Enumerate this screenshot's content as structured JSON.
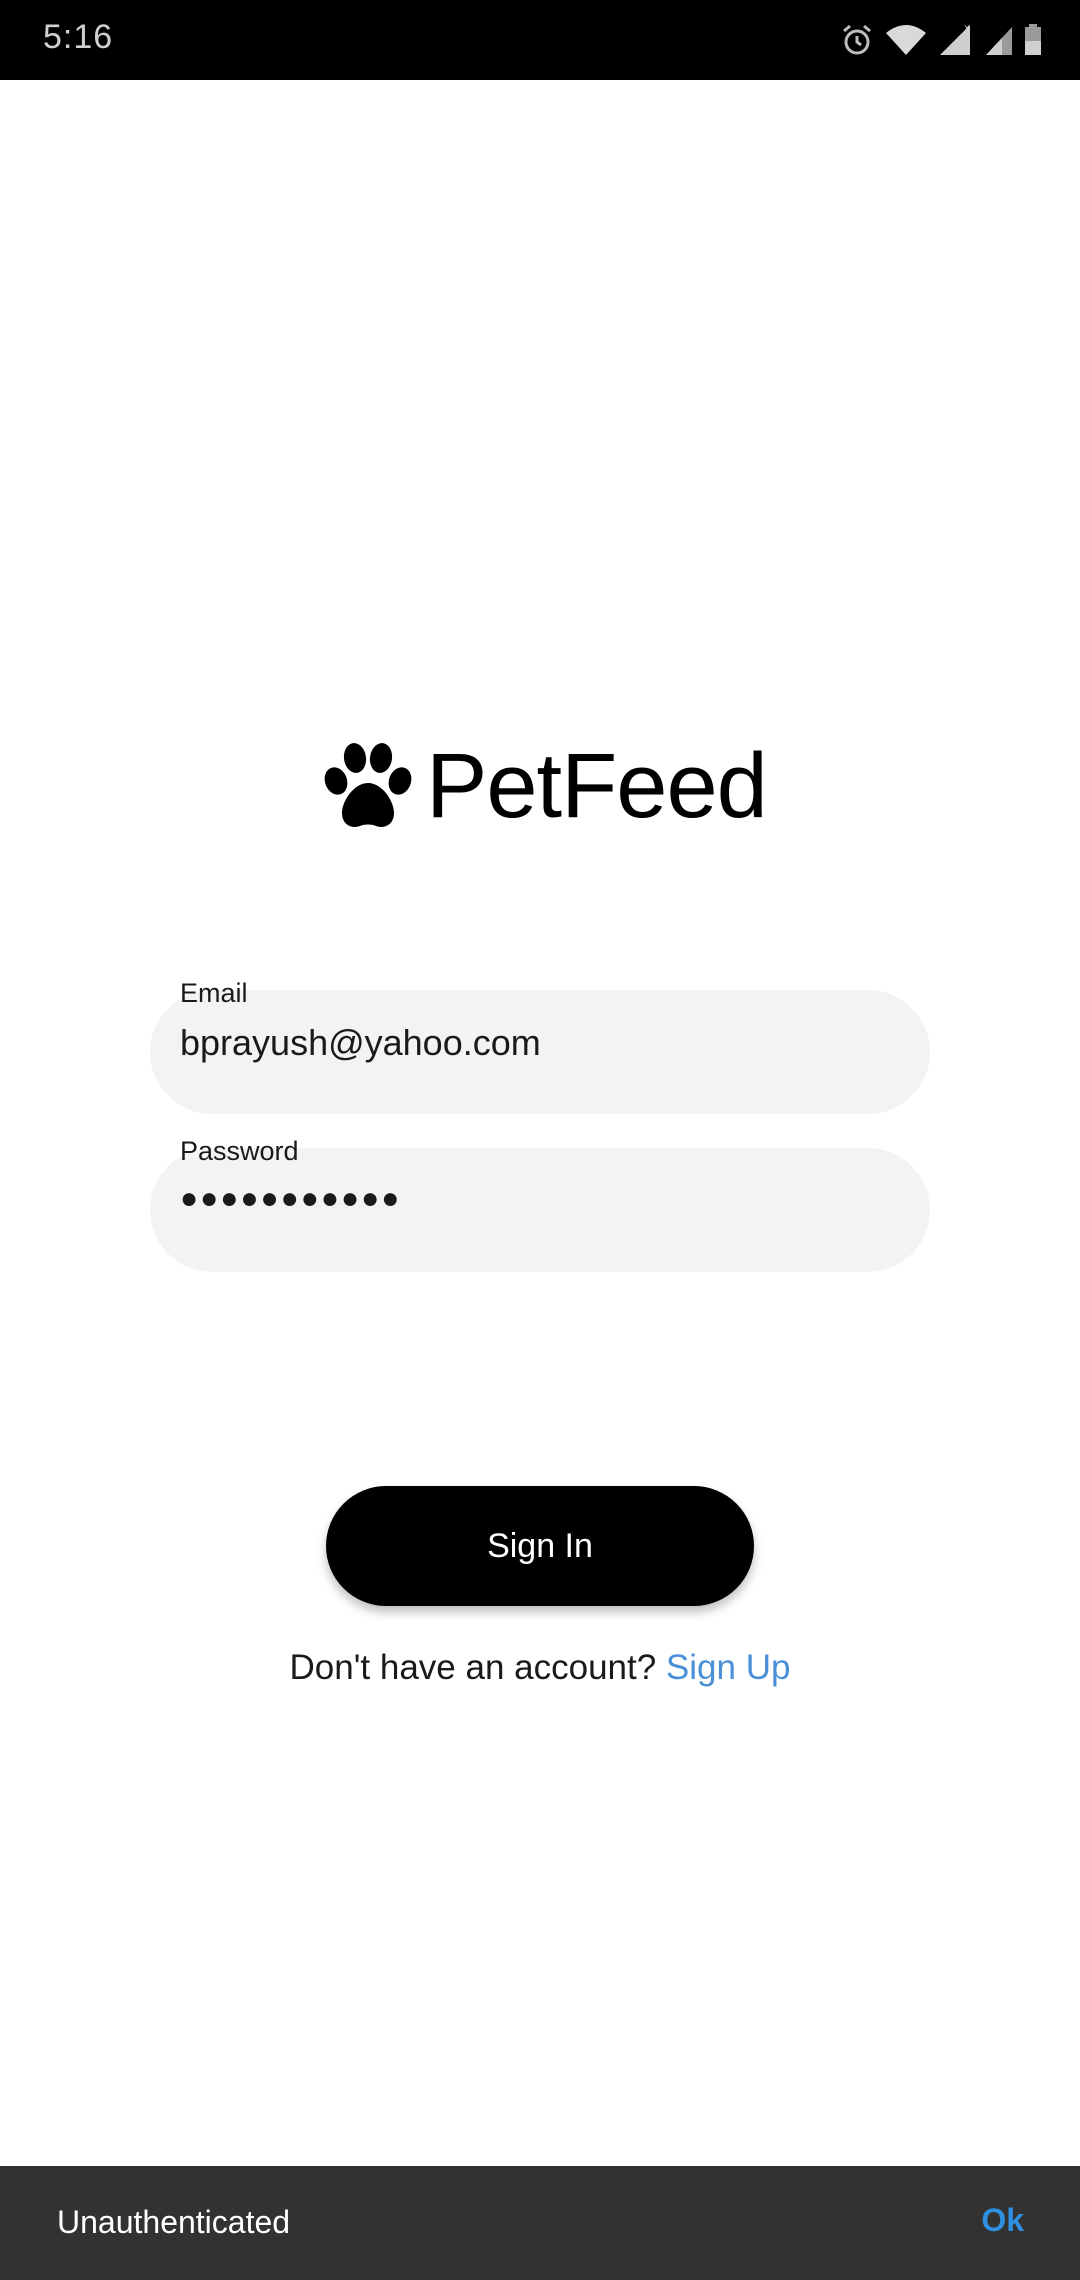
{
  "status_bar": {
    "time": "5:16",
    "icons": [
      "alarm-icon",
      "wifi-icon",
      "signal-icon",
      "signal-icon",
      "battery-icon"
    ]
  },
  "logo": {
    "icon": "paw-icon",
    "text": "PetFeed"
  },
  "form": {
    "email": {
      "label": "Email",
      "value": "bprayush@yahoo.com"
    },
    "password": {
      "label": "Password",
      "value": "●●●●●●●●●●●"
    },
    "sign_in_label": "Sign In"
  },
  "signup": {
    "prompt": "Don't have an account?",
    "link": "Sign Up"
  },
  "snackbar": {
    "message": "Unauthenticated",
    "action": "Ok"
  },
  "colors": {
    "accent": "#4a90d9",
    "snackbar_action": "#2f8fe0",
    "button_bg": "#000000",
    "field_bg": "#f3f3f3"
  }
}
